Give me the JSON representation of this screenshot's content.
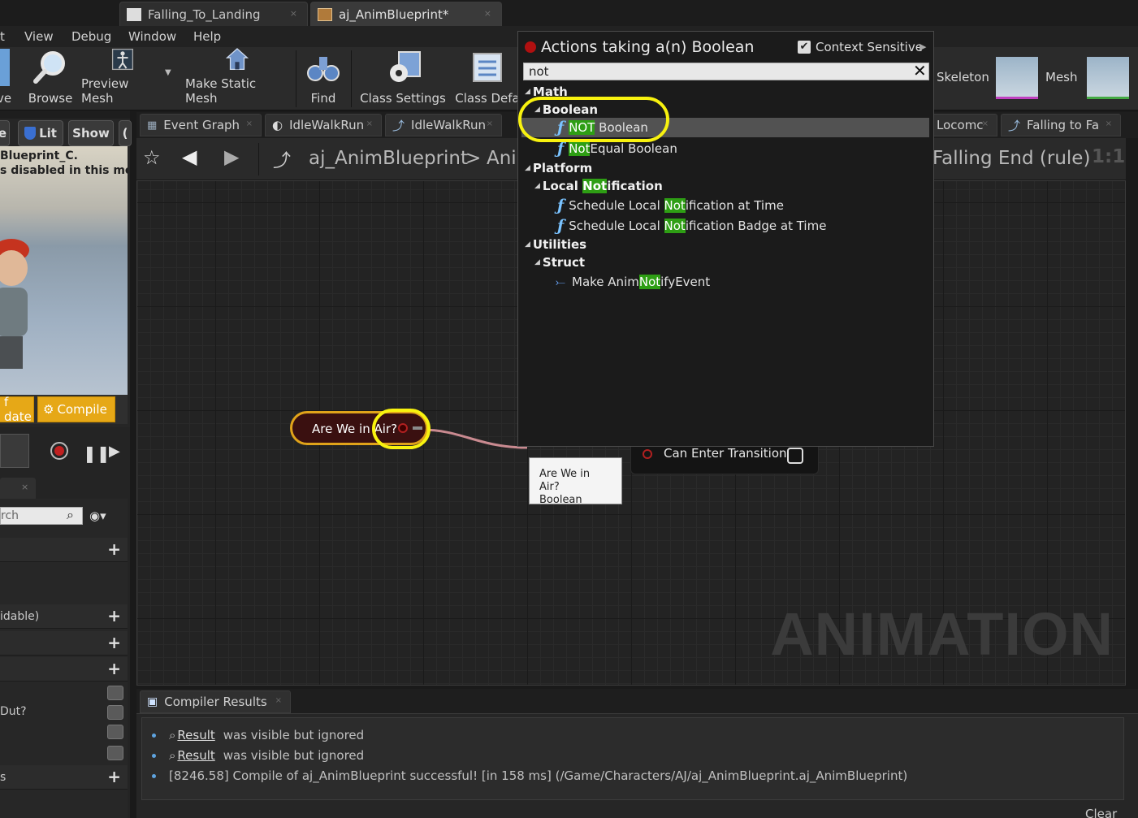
{
  "title_tabs": [
    {
      "label": "Falling_To_Landing"
    },
    {
      "label": "aj_AnimBlueprint*"
    }
  ],
  "menu": [
    "t",
    "View",
    "Debug",
    "Window",
    "Help"
  ],
  "toolbar": {
    "partial_left": "ve",
    "browse": "Browse",
    "preview_mesh": "Preview Mesh",
    "make_static_mesh": "Make Static Mesh",
    "find": "Find",
    "class_settings": "Class Settings",
    "class_defaults": "Class Defa",
    "skeleton": "Skeleton",
    "mesh": "Mesh"
  },
  "viewport": {
    "partial_btn": "e",
    "lit": "Lit",
    "show": "Show",
    "partial_c": "(",
    "overlay_line1": "Blueprint_C.",
    "overlay_line2": "s disabled in this mode",
    "update_partial": "f date",
    "compile_label": "Compile"
  },
  "left_panel": {
    "tab_x": "×",
    "search_partial": "rch",
    "row_editable": "idable)",
    "row_out": "Dut?",
    "row_s": "s"
  },
  "graph_tabs": [
    {
      "label": "Event Graph"
    },
    {
      "label": "IdleWalkRun"
    },
    {
      "label": "IdleWalkRun"
    },
    {
      "label": "Locomc"
    },
    {
      "label": "Falling to Fa"
    }
  ],
  "breadcrumb": {
    "root": "aj_AnimBlueprint",
    "separator": ">",
    "child": "Ani",
    "right_title": "Falling End (rule)",
    "zoom": "1:1"
  },
  "graph": {
    "watermark": "ANIMATION",
    "var_node_label": "Are We in Air?",
    "result_pin_label": "Can Enter Transition",
    "tooltip_line1": "Are We in Air?",
    "tooltip_line2": "Boolean"
  },
  "action_menu": {
    "title": "Actions taking a(n) Boolean",
    "context_sensitive": "Context Sensitive",
    "search_value": "not",
    "categories": {
      "math": "Math",
      "boolean": "Boolean",
      "platform": "Platform",
      "local_notification": "Local Notification",
      "utilities": "Utilities",
      "struct": "Struct"
    },
    "items": {
      "not_boolean": {
        "hl": "NOT",
        "rest": " Boolean"
      },
      "not_equal_boolean": {
        "hl": "Not",
        "rest": "Equal Boolean"
      },
      "schedule_at_time": {
        "pre": "Schedule Local ",
        "hl": "Not",
        "rest": "ification at Time"
      },
      "schedule_badge": {
        "pre": "Schedule Local ",
        "hl": "Not",
        "rest": "ification Badge at Time"
      },
      "make_notify": {
        "pre": "Make Anim",
        "hl": "Not",
        "rest": "ifyEvent"
      }
    },
    "local_notification_parts": {
      "pre": "Local ",
      "hl": "Not",
      "rest": "ification"
    }
  },
  "compiler": {
    "tab_label": "Compiler Results",
    "lines": [
      {
        "link": "Result",
        "text": "was visible but ignored"
      },
      {
        "link": "Result",
        "text": "was visible but ignored"
      },
      {
        "text": "[8246.58] Compile of aj_AnimBlueprint successful! [in 158 ms] (/Game/Characters/AJ/aj_AnimBlueprint.aj_AnimBlueprint)"
      }
    ],
    "clear": "Clear"
  },
  "colors": {
    "highlight": "#2e9e14",
    "annotation_ring": "#f8f20f",
    "compile_button": "#e6a817",
    "var_node_border": "#e0a31a"
  }
}
